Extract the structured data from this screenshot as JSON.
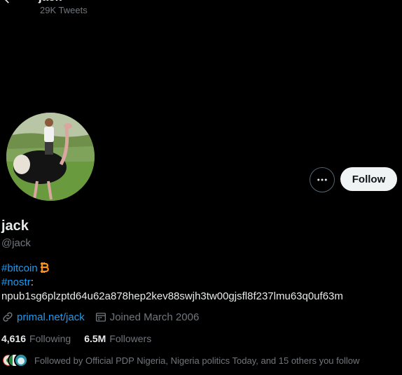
{
  "header": {
    "tweet_count": "29K Tweets"
  },
  "profile": {
    "display_name": "jack",
    "handle": "@jack",
    "bio": {
      "hashtag_bitcoin": "#bitcoin",
      "hashtag_nostr": "#nostr",
      "nostr_colon": ":",
      "npub": "npub1sg6plzptd64u62a878hep2kev88swjh3tw00gjsfl8f237lmu63q0uf63m"
    },
    "website": "primal.net/jack",
    "joined": "Joined March 2006",
    "following_count": "4,616",
    "following_label": "Following",
    "followers_count": "6.5M",
    "followers_label": "Followers",
    "followed_by": "Followed by Official PDP Nigeria, Nigeria politics Today, and 15 others you follow"
  },
  "actions": {
    "follow_label": "Follow"
  },
  "icons": {
    "back": "arrow-left-icon",
    "more": "more-horizontal-icon",
    "link": "link-icon",
    "calendar": "calendar-icon",
    "bitcoin": "bitcoin-icon"
  },
  "colors": {
    "background": "#000000",
    "text_primary": "#e7e9ea",
    "text_secondary": "#71767b",
    "accent": "#1d9bf0",
    "follow_button_bg": "#eff3f4",
    "bitcoin": "#f7931a"
  }
}
